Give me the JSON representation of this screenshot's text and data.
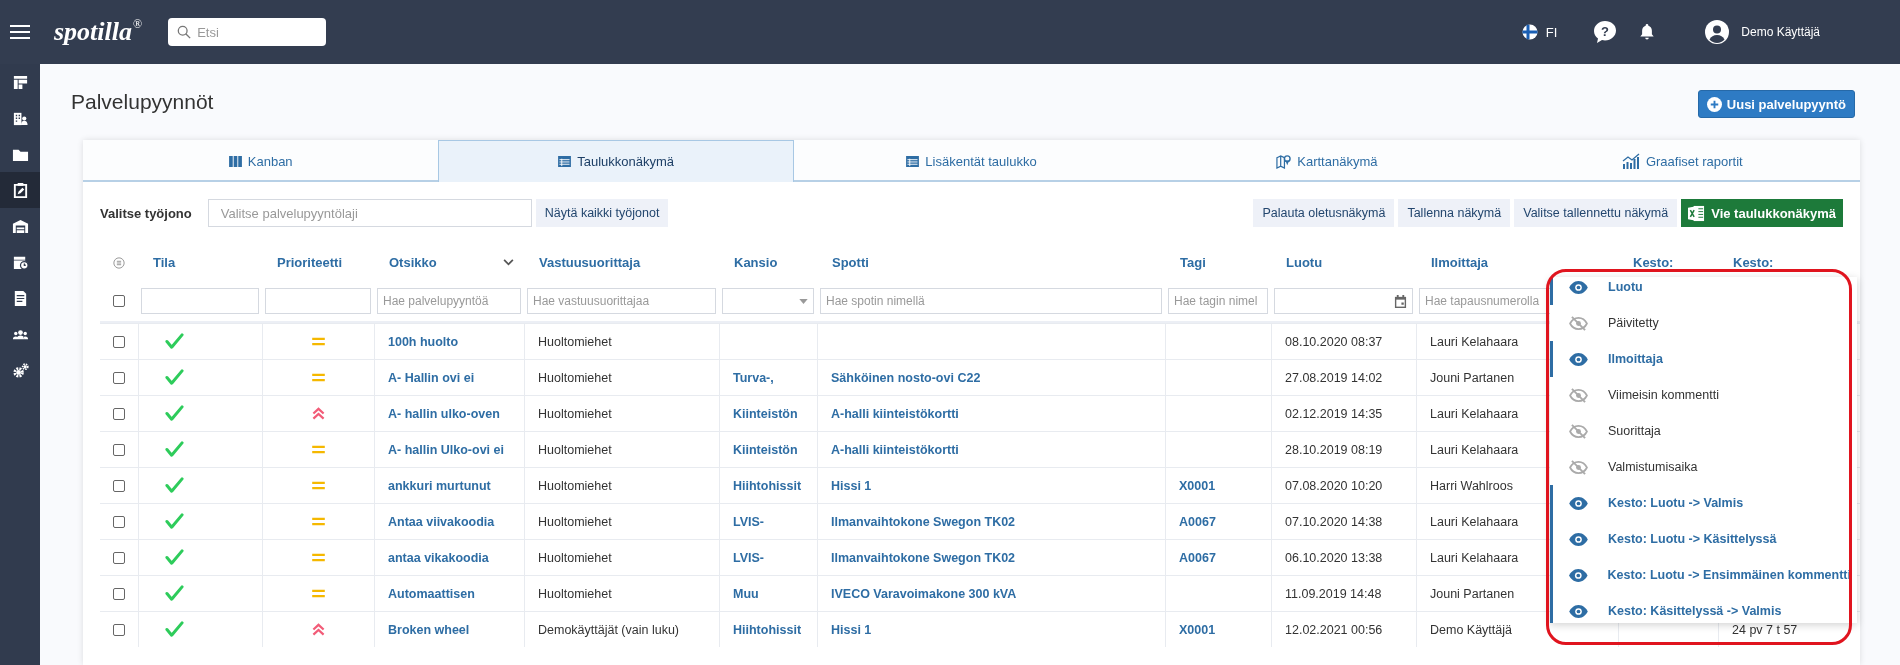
{
  "topbar": {
    "logo": "spotilla",
    "logo_mark": "®",
    "search": {
      "placeholder": "Etsi"
    },
    "language": "FI",
    "help": "?",
    "user": "Demo Käyttäjä"
  },
  "sidebar": {
    "items": [
      {
        "kind": "dashboard",
        "selected": false
      },
      {
        "kind": "buildings",
        "selected": false
      },
      {
        "kind": "folder",
        "selected": false
      },
      {
        "kind": "clipboard",
        "selected": true
      },
      {
        "kind": "warehouse",
        "selected": false
      },
      {
        "kind": "calendar",
        "selected": false
      },
      {
        "kind": "report",
        "selected": false
      },
      {
        "kind": "users",
        "selected": false
      },
      {
        "kind": "gears",
        "selected": false
      }
    ]
  },
  "page": {
    "title": "Palvelupyynnöt",
    "new_button": "Uusi palvelupyyntö"
  },
  "tabs": [
    {
      "label": "Kanban",
      "kind": "columns",
      "selected": false
    },
    {
      "label": "Taulukkonäkymä",
      "kind": "table",
      "selected": true
    },
    {
      "label": "Lisäkentät taulukko",
      "kind": "table",
      "selected": false
    },
    {
      "label": "Karttanäkymä",
      "kind": "map",
      "selected": false
    },
    {
      "label": "Graafiset raportit",
      "kind": "chart",
      "selected": false
    }
  ],
  "toolbar": {
    "queue_label": "Valitse työjono",
    "queue": {
      "placeholder": "Valitse palvelupyyntölaji"
    },
    "show_all": "Näytä kaikki työjonot",
    "buttons": [
      "Palauta oletusnäkymä",
      "Tallenna näkymä",
      "Valitse tallennettu näkymä"
    ],
    "export": "Vie taulukkonäkymä"
  },
  "table": {
    "select_all_checked": false,
    "columns": [
      {
        "label": "Tila",
        "filter": {
          "kind": "text"
        }
      },
      {
        "label": "Prioriteetti",
        "filter": {
          "kind": "text"
        }
      },
      {
        "label": "Otsikko",
        "has_menu": true,
        "filter": {
          "kind": "text",
          "placeholder": "Hae palvelupyyntöä"
        }
      },
      {
        "label": "Vastuusuorittaja",
        "filter": {
          "kind": "text",
          "placeholder": "Hae vastuusuorittajaa"
        }
      },
      {
        "label": "Kansio",
        "filter": {
          "kind": "select"
        }
      },
      {
        "label": "Spotti",
        "filter": {
          "kind": "text",
          "placeholder": "Hae spotin nimellä"
        }
      },
      {
        "label": "Tagi",
        "filter": {
          "kind": "text",
          "placeholder": "Hae tagin nimel"
        }
      },
      {
        "label": "Luotu",
        "filter": {
          "kind": "date"
        }
      },
      {
        "label": "Ilmoittaja",
        "filter": {
          "kind": "text",
          "placeholder": "Hae tapausnumerolla"
        }
      },
      {
        "label": "Kesto:"
      },
      {
        "label": "Kesto:"
      }
    ],
    "rows": [
      {
        "checked": false,
        "status": {
          "kind": "done"
        },
        "priority": {
          "kind": "normal"
        },
        "title": "100h huolto",
        "assignee": "Huoltomiehet",
        "created": "08.10.2020 08:37",
        "reporter": "Lauri Kelahaara"
      },
      {
        "checked": false,
        "status": {
          "kind": "done"
        },
        "priority": {
          "kind": "normal"
        },
        "title": "A- Hallin ovi ei",
        "assignee": "Huoltomiehet",
        "folder": "Turva-,",
        "spot": "Sähköinen nosto-ovi C22",
        "created": "27.08.2019 14:02",
        "reporter": "Jouni Partanen"
      },
      {
        "checked": false,
        "status": {
          "kind": "done"
        },
        "priority": {
          "kind": "high"
        },
        "title": "A- hallin ulko-oven",
        "assignee": "Huoltomiehet",
        "folder": "Kiinteistön",
        "spot": "A-halli kiinteistökortti",
        "created": "02.12.2019 14:35",
        "reporter": "Lauri Kelahaara"
      },
      {
        "checked": false,
        "status": {
          "kind": "done"
        },
        "priority": {
          "kind": "normal"
        },
        "title": "A- hallin Ulko-ovi ei",
        "assignee": "Huoltomiehet",
        "folder": "Kiinteistön",
        "spot": "A-halli kiinteistökortti",
        "created": "28.10.2019 08:19",
        "reporter": "Lauri Kelahaara"
      },
      {
        "checked": false,
        "status": {
          "kind": "done"
        },
        "priority": {
          "kind": "normal"
        },
        "title": "ankkuri murtunut",
        "assignee": "Huoltomiehet",
        "folder": "Hiihtohissit",
        "spot": "Hissi 1",
        "tag": "X0001",
        "created": "07.08.2020 10:20",
        "reporter": "Harri Wahlroos"
      },
      {
        "checked": false,
        "status": {
          "kind": "done"
        },
        "priority": {
          "kind": "normal"
        },
        "title": "Antaa viivakoodia",
        "assignee": "Huoltomiehet",
        "folder": "LVIS-",
        "spot": "Ilmanvaihtokone Swegon TK02",
        "tag": "A0067",
        "created": "07.10.2020 14:38",
        "reporter": "Lauri Kelahaara"
      },
      {
        "checked": false,
        "status": {
          "kind": "done"
        },
        "priority": {
          "kind": "normal"
        },
        "title": "antaa vikakoodia",
        "assignee": "Huoltomiehet",
        "folder": "LVIS-",
        "spot": "Ilmanvaihtokone Swegon TK02",
        "tag": "A0067",
        "created": "06.10.2020 13:38",
        "reporter": "Lauri Kelahaara"
      },
      {
        "checked": false,
        "status": {
          "kind": "done"
        },
        "priority": {
          "kind": "normal"
        },
        "title": "Automaattisen",
        "assignee": "Huoltomiehet",
        "folder": "Muu",
        "spot": "IVECO Varavoimakone 300 kVA",
        "created": "11.09.2019 14:48",
        "reporter": "Jouni Partanen"
      },
      {
        "checked": false,
        "status": {
          "kind": "done"
        },
        "priority": {
          "kind": "high"
        },
        "title": "Broken wheel",
        "assignee": "Demokäyttäjät (vain luku)",
        "folder": "Hiihtohissit",
        "spot": "Hissi 1",
        "tag": "X0001",
        "created": "12.02.2021 00:56",
        "reporter": "Demo Käyttäjä",
        "column_10": "24 pv 7 t 57"
      }
    ]
  },
  "column_menu": {
    "highlighted": true,
    "items": [
      {
        "label": "Luotu",
        "visible": true
      },
      {
        "label": "Päivitetty",
        "visible": false
      },
      {
        "label": "Ilmoittaja",
        "visible": true
      },
      {
        "label": "Viimeisin kommentti",
        "visible": false
      },
      {
        "label": "Suorittaja",
        "visible": false
      },
      {
        "label": "Valmistumisaika",
        "visible": false
      },
      {
        "label": "Kesto: Luotu -> Valmis",
        "visible": true
      },
      {
        "label": "Kesto: Luotu -> Käsittelyssä",
        "visible": true
      },
      {
        "label": "Kesto: Luotu -> Ensimmäinen kommentti",
        "visible": true
      },
      {
        "label": "Kesto: Käsittelyssä -> Valmis",
        "visible": true
      }
    ]
  }
}
